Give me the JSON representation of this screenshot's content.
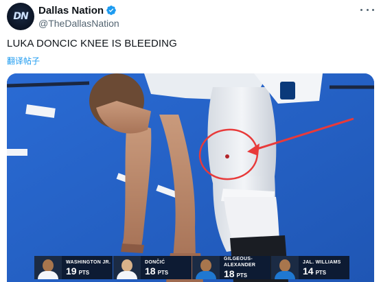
{
  "post": {
    "display_name": "Dallas Nation",
    "handle": "@TheDallasNation",
    "avatar_text": "DN",
    "text": "LUKA DONCIC KNEE IS BLEEDING",
    "translate_label": "翻译帖子"
  },
  "icons": {
    "avatar": "dallas-nation-logo",
    "verified": "verified-badge-icon",
    "more": "more-options-icon",
    "annotation_arrow": "red-arrow",
    "annotation_circle": "red-circle"
  },
  "colors": {
    "verified": "#1d9bf0",
    "link": "#1d9bf0",
    "annotation": "#e83a3a",
    "court": "#2563c9"
  },
  "scoreboard": [
    {
      "name": "WASHINGTON JR.",
      "points": "19",
      "unit": "PTS"
    },
    {
      "name": "DONČIĆ",
      "points": "18",
      "unit": "PTS"
    },
    {
      "name": "GILGEOUS-ALEXANDER",
      "points": "18",
      "unit": "PTS"
    },
    {
      "name": "JAL. WILLIAMS",
      "points": "14",
      "unit": "PTS"
    }
  ]
}
